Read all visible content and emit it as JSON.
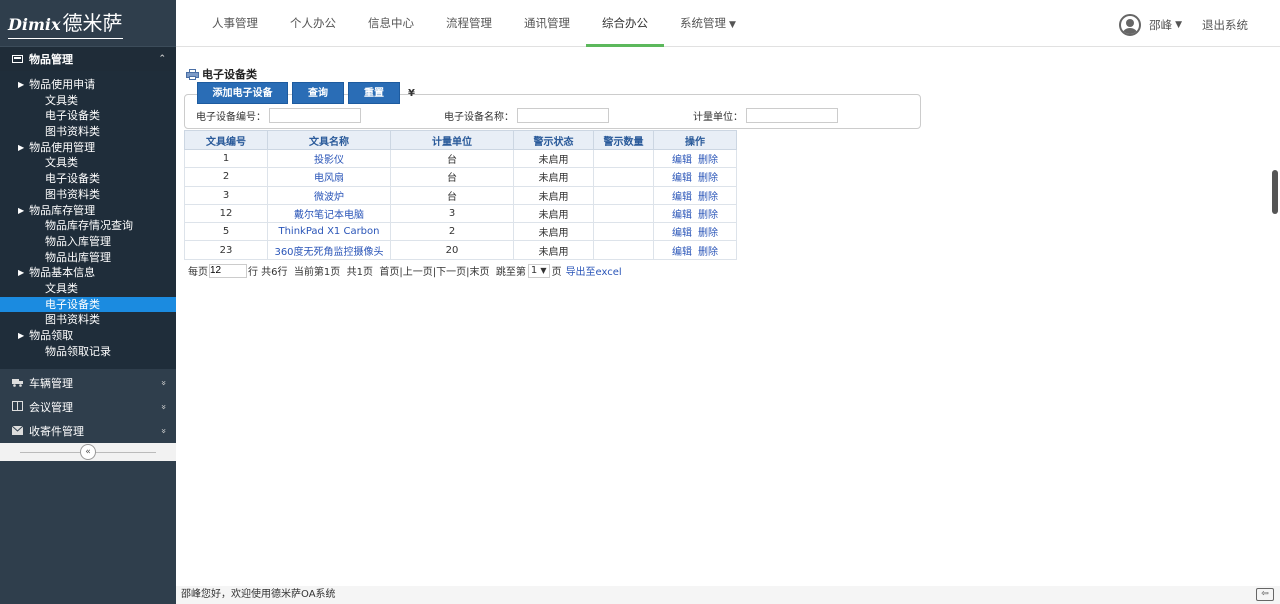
{
  "logo": {
    "en": "Dimix",
    "cn": "德米萨"
  },
  "sidebar": {
    "active_section": {
      "label": "物品管理",
      "icon": "box-icon",
      "chevron": "⌃"
    },
    "tree": [
      {
        "type": "group",
        "label": "物品使用申请"
      },
      {
        "type": "leaf",
        "label": "文具类"
      },
      {
        "type": "leaf",
        "label": "电子设备类"
      },
      {
        "type": "leaf",
        "label": "图书资料类"
      },
      {
        "type": "group",
        "label": "物品使用管理"
      },
      {
        "type": "leaf",
        "label": "文具类"
      },
      {
        "type": "leaf",
        "label": "电子设备类"
      },
      {
        "type": "leaf",
        "label": "图书资料类"
      },
      {
        "type": "group",
        "label": "物品库存管理"
      },
      {
        "type": "leaf",
        "label": "物品库存情况查询"
      },
      {
        "type": "leaf",
        "label": "物品入库管理"
      },
      {
        "type": "leaf",
        "label": "物品出库管理"
      },
      {
        "type": "group",
        "label": "物品基本信息"
      },
      {
        "type": "leaf",
        "label": "文具类"
      },
      {
        "type": "leaf",
        "label": "电子设备类",
        "selected": true
      },
      {
        "type": "leaf",
        "label": "图书资料类"
      },
      {
        "type": "group",
        "label": "物品领取"
      },
      {
        "type": "leaf",
        "label": "物品领取记录"
      }
    ],
    "sections": [
      {
        "label": "车辆管理",
        "icon": "truck-icon"
      },
      {
        "label": "会议管理",
        "icon": "columns-icon"
      },
      {
        "label": "收寄件管理",
        "icon": "envelope-icon"
      }
    ],
    "collapse_glyph": "«"
  },
  "nav": {
    "items": [
      "人事管理",
      "个人办公",
      "信息中心",
      "流程管理",
      "通讯管理",
      "综合办公",
      "系统管理"
    ],
    "active": "综合办公",
    "user": "邵峰",
    "logout": "退出系统"
  },
  "page": {
    "title": "电子设备类",
    "buttons": {
      "add": "添加电子设备",
      "query": "查询",
      "reset": "重置"
    },
    "fields": {
      "code_label": "电子设备编号：",
      "name_label": "电子设备名称：",
      "unit_label": "计量单位："
    }
  },
  "table": {
    "headers": [
      "文具编号",
      "文具名称",
      "计量单位",
      "警示状态",
      "警示数量",
      "操作"
    ],
    "rows": [
      {
        "id": "1",
        "name": "投影仪",
        "unit": "台",
        "status": "未启用",
        "qty": "",
        "edit": "编辑",
        "del": "删除"
      },
      {
        "id": "2",
        "name": "电风扇",
        "unit": "台",
        "status": "未启用",
        "qty": "",
        "edit": "编辑",
        "del": "删除"
      },
      {
        "id": "3",
        "name": "微波炉",
        "unit": "台",
        "status": "未启用",
        "qty": "",
        "edit": "编辑",
        "del": "删除"
      },
      {
        "id": "12",
        "name": "戴尔笔记本电脑",
        "unit": "3",
        "status": "未启用",
        "qty": "",
        "edit": "编辑",
        "del": "删除"
      },
      {
        "id": "5",
        "name": "ThinkPad X1 Carbon",
        "unit": "2",
        "status": "未启用",
        "qty": "",
        "edit": "编辑",
        "del": "删除"
      },
      {
        "id": "23",
        "name": "360度无死角监控摄像头",
        "unit": "20",
        "status": "未启用",
        "qty": "",
        "edit": "编辑",
        "del": "删除"
      }
    ]
  },
  "pager": {
    "per_page_label": "每页",
    "per_page_value": "12",
    "rows_label": "行 共6行",
    "current": "当前第1页",
    "total": "共1页",
    "links": "首页|上一页|下一页|末页",
    "jump_label": "跳至第",
    "jump_value": "1",
    "page_suffix": "页",
    "export": "导出至excel"
  },
  "status": {
    "text": "邵峰您好，欢迎使用德米萨OA系统"
  }
}
